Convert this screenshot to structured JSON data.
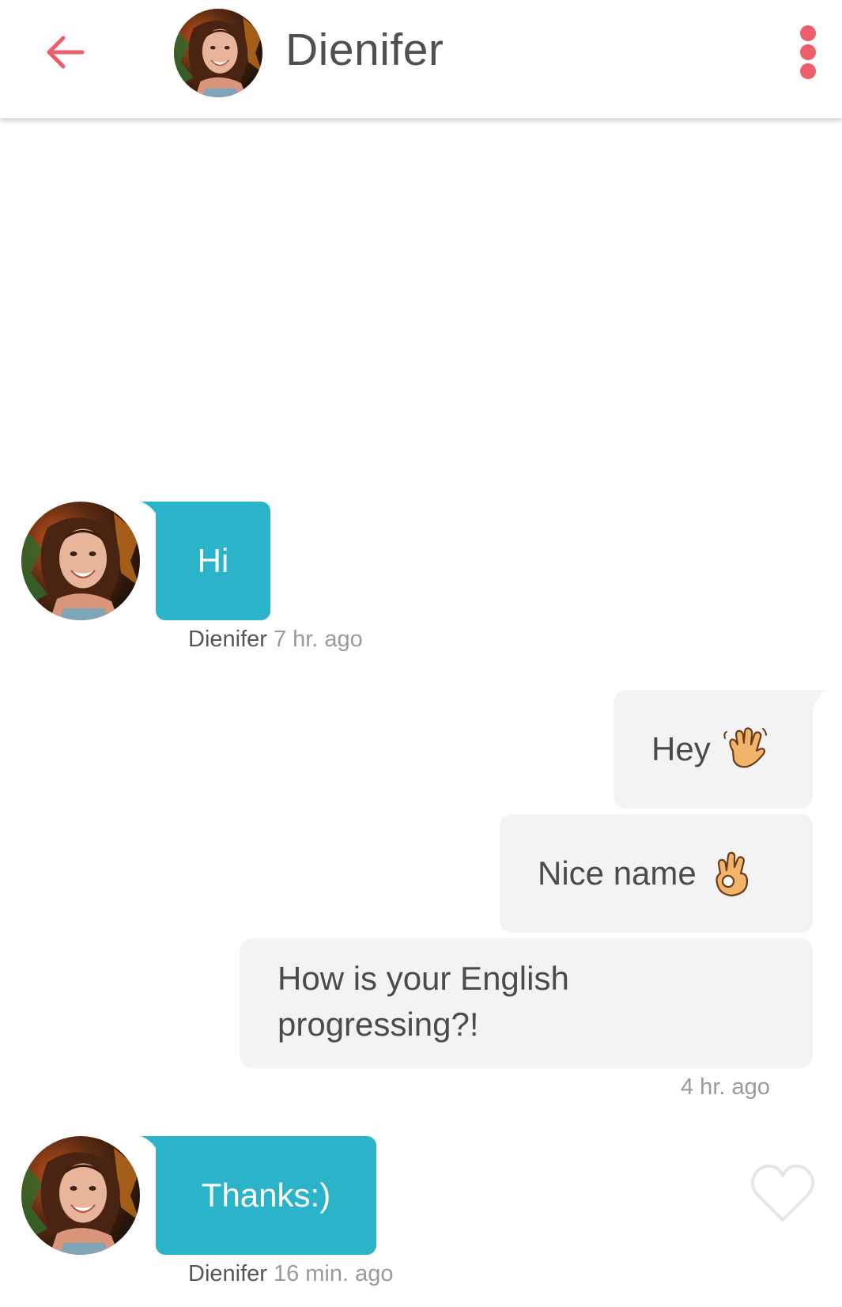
{
  "header": {
    "contact_name": "Dienifer",
    "accent_color": "#ec5e68",
    "back_icon": "arrow-left-icon",
    "menu_icon": "more-vertical-icon"
  },
  "messages": [
    {
      "direction": "incoming",
      "text": "Hi",
      "sender": "Dienifer",
      "time": "7 hr. ago"
    },
    {
      "direction": "outgoing",
      "text": "Hey",
      "emoji": "waving-hand-icon"
    },
    {
      "direction": "outgoing",
      "text": "Nice name",
      "emoji": "ok-hand-icon"
    },
    {
      "direction": "outgoing",
      "text_line1": "How is your English",
      "text_line2": "progressing?!",
      "time": "4 hr. ago"
    },
    {
      "direction": "incoming",
      "text": "Thanks:)",
      "sender": "Dienifer",
      "time": "16 min. ago",
      "like_icon": "heart-outline-icon"
    }
  ],
  "colors": {
    "incoming_bubble": "#2bb3c9",
    "outgoing_bubble": "#f3f3f3"
  }
}
